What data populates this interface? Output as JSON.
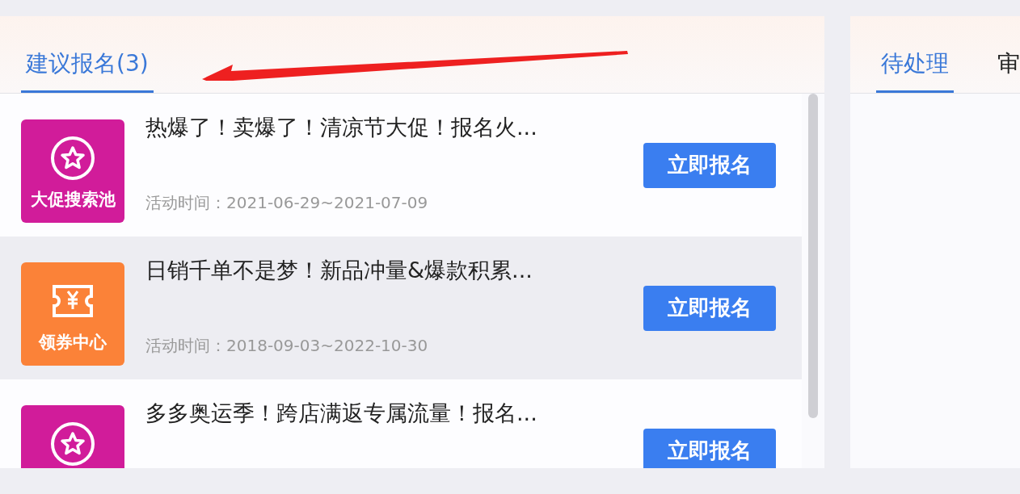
{
  "suggested_panel": {
    "tabs": [
      {
        "label": "建议报名(3)",
        "selected": true
      }
    ],
    "activities": [
      {
        "tile": {
          "kind": "star",
          "label": "大促搜索池",
          "color": "#d11c9a"
        },
        "title": "热爆了！卖爆了！清凉节大促！报名火...",
        "date": "活动时间：2021-06-29~2021-07-09",
        "highlighted": false,
        "button": "立即报名"
      },
      {
        "tile": {
          "kind": "coupon",
          "label": "领券中心",
          "color": "#fb8238"
        },
        "title": "日销千单不是梦！新品冲量&爆款积累...",
        "date": "活动时间：2018-09-03~2022-10-30",
        "highlighted": true,
        "button": "立即报名"
      },
      {
        "tile": {
          "kind": "star",
          "color": "#d11c9a"
        },
        "title": "多多奥运季！跨店满返专属流量！报名...",
        "highlighted": false,
        "button": "立即报名"
      }
    ]
  },
  "todo_panel": {
    "tabs": [
      {
        "label": "待处理",
        "selected": true
      },
      {
        "label": "审",
        "selected": false
      }
    ]
  }
}
